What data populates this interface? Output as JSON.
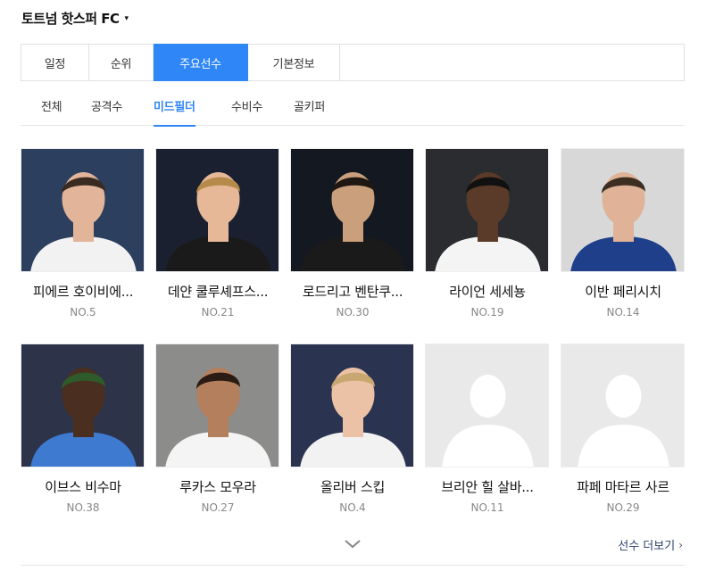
{
  "team": {
    "name": "토트넘 핫스퍼 FC",
    "caret": "▾"
  },
  "main_tabs": [
    {
      "label": "일정",
      "active": false
    },
    {
      "label": "순위",
      "active": false
    },
    {
      "label": "주요선수",
      "active": true
    },
    {
      "label": "기본정보",
      "active": false
    }
  ],
  "sub_tabs": [
    {
      "label": "전체",
      "active": false
    },
    {
      "label": "공격수",
      "active": false
    },
    {
      "label": "미드필더",
      "active": true
    },
    {
      "label": "수비수",
      "active": false
    },
    {
      "label": "골키퍼",
      "active": false
    }
  ],
  "players": [
    {
      "name": "피에르 호이비에...",
      "number": "NO.5",
      "bg": "#2c3f5e",
      "shirt": "#f2f2f2",
      "skin": "#e2b49a",
      "hair": "#3a2b22"
    },
    {
      "name": "데얀 쿨루셰프스...",
      "number": "NO.21",
      "bg": "#1b2030",
      "shirt": "#1a1a1a",
      "skin": "#e6b898",
      "hair": "#b58a4a"
    },
    {
      "name": "로드리고 벤탄쿠...",
      "number": "NO.30",
      "bg": "#141821",
      "shirt": "#1a1a1a",
      "skin": "#caa07c",
      "hair": "#1e1712"
    },
    {
      "name": "라이언 세세뇽",
      "number": "NO.19",
      "bg": "#2b2c30",
      "shirt": "#f4f4f4",
      "skin": "#5a3a28",
      "hair": "#111111"
    },
    {
      "name": "이반 페리시치",
      "number": "NO.14",
      "bg": "#d8d8d8",
      "shirt": "#1f3f8a",
      "skin": "#e0b398",
      "hair": "#3d2e22"
    },
    {
      "name": "이브스 비수마",
      "number": "NO.38",
      "bg": "#2d3348",
      "shirt": "#3d7ad0",
      "skin": "#4a2e20",
      "hair": "#2f5a2a"
    },
    {
      "name": "루카스 모우라",
      "number": "NO.27",
      "bg": "#8c8c8a",
      "shirt": "#f4f4f4",
      "skin": "#b47f5c",
      "hair": "#2a1c14"
    },
    {
      "name": "올리버 스킵",
      "number": "NO.4",
      "bg": "#2a3350",
      "shirt": "#f2f2f2",
      "skin": "#ecc2a6",
      "hair": "#c9a770"
    },
    {
      "name": "브리안 힐 살바...",
      "number": "NO.11",
      "placeholder": true
    },
    {
      "name": "파페 마타르 사르",
      "number": "NO.29",
      "placeholder": true
    }
  ],
  "footer": {
    "see_more": "선수 더보기",
    "arrow": "›"
  },
  "icons": {
    "expand": "chevron-down-icon",
    "see_more": "chevron-right-icon"
  },
  "colors": {
    "accent": "#2f86f6"
  }
}
